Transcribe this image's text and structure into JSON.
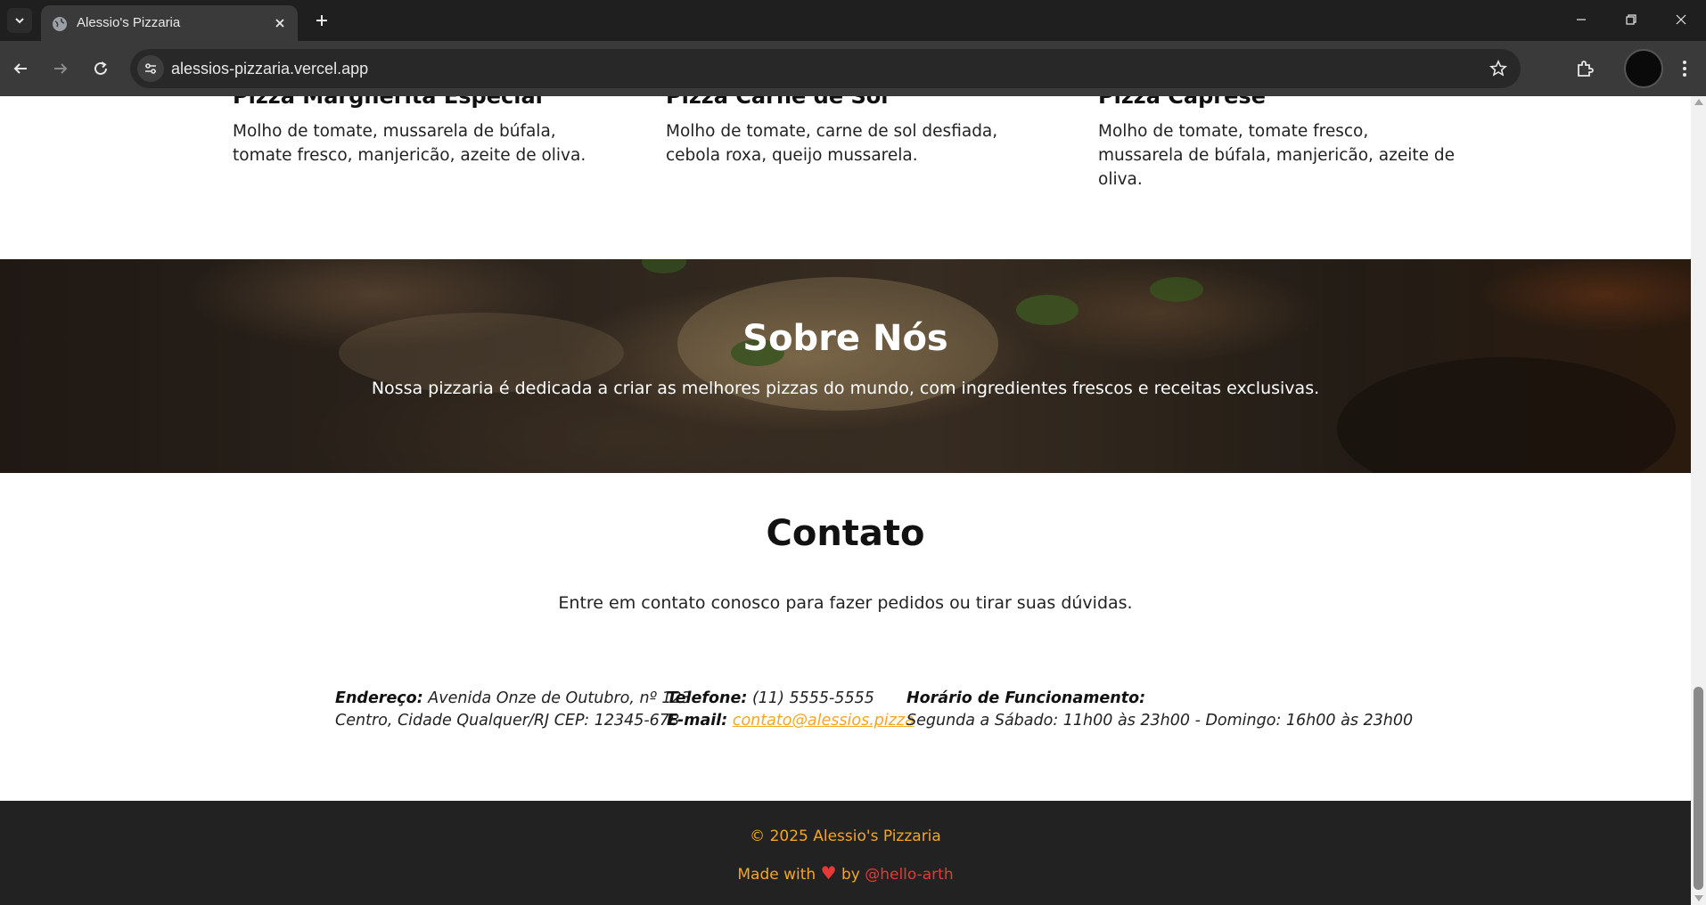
{
  "browser": {
    "tab_title": "Alessio's Pizzaria",
    "url": "alessios-pizzaria.vercel.app"
  },
  "menu": {
    "items": [
      {
        "name": "Pizza Margherita Especial",
        "description": "Molho de tomate, mussarela de búfala, tomate fresco, manjericão, azeite de oliva."
      },
      {
        "name": "Pizza Carne de Sol",
        "description": "Molho de tomate, carne de sol desfiada, cebola roxa, queijo mussarela."
      },
      {
        "name": "Pizza Caprese",
        "description": "Molho de tomate, tomate fresco, mussarela de búfala, manjericão, azeite de oliva."
      }
    ]
  },
  "about": {
    "title": "Sobre Nós",
    "text": "Nossa pizzaria é dedicada a criar as melhores pizzas do mundo, com ingredientes frescos e receitas exclusivas."
  },
  "contact": {
    "title": "Contato",
    "subtitle": "Entre em contato conosco para fazer pedidos ou tirar suas dúvidas.",
    "address_label": "Endereço:",
    "address_line1": "Avenida Onze de Outubro, nº 123",
    "address_line2": "Centro, Cidade Qualquer/RJ CEP: 12345-678",
    "phone_label": "Telefone:",
    "phone": "(11) 5555-5555",
    "email_label": "E-mail:",
    "email": "contato@alessios.pizza",
    "hours_label": "Horário de Funcionamento:",
    "hours": "Segunda a Sábado: 11h00 às 23h00 - Domingo: 16h00 às 23h00"
  },
  "footer": {
    "copyright": "© 2025 Alessio's Pizzaria",
    "made_with": "Made with",
    "by": "by",
    "handle": "@hello-arth"
  },
  "colors": {
    "accent": "#f5a623",
    "heart": "#e53935",
    "footer_bg": "#222222"
  }
}
